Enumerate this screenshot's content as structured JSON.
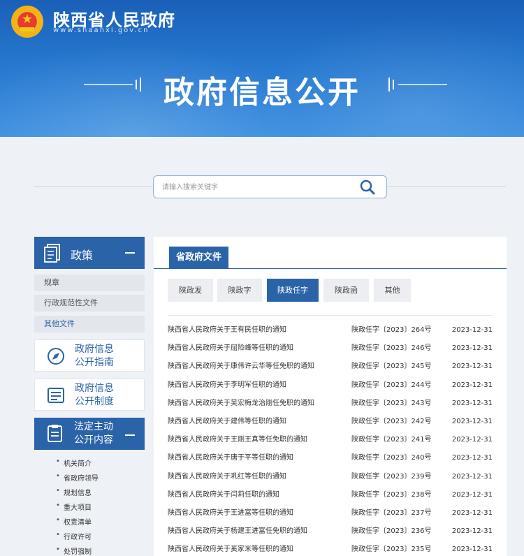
{
  "header": {
    "site_name": "陕西省人民政府",
    "site_url": "www.shaanxi.gov.cn",
    "page_title": "政府信息公开"
  },
  "search": {
    "placeholder": "请输入搜索关键字"
  },
  "sidebar": {
    "policy_title": "政策",
    "policy_items": [
      "规章",
      "行政规范性文件",
      "其他文件"
    ],
    "guide_title": [
      "政府信息",
      "公开指南"
    ],
    "system_title": [
      "政府信息",
      "公开制度"
    ],
    "proactive_title": [
      "法定主动",
      "公开内容"
    ],
    "proactive_items": [
      "机关简介",
      "省政府领导",
      "规划信息",
      "重大项目",
      "权责清单",
      "行政许可",
      "处罚强制"
    ]
  },
  "main": {
    "tab_label": "省政府文件",
    "filters": [
      "陕政发",
      "陕政字",
      "陕政任字",
      "陕政函",
      "其他"
    ],
    "active_filter": "陕政任字",
    "documents": [
      {
        "title": "陕西省人民政府关于王有民任职的通知",
        "number": "陕政任字〔2023〕264号",
        "date": "2023-12-31"
      },
      {
        "title": "陕西省人民政府关于屈险峰等任职的通知",
        "number": "陕政任字〔2023〕246号",
        "date": "2023-12-31"
      },
      {
        "title": "陕西省人民政府关于康伟许云华等任免职的通知",
        "number": "陕政任字〔2023〕245号",
        "date": "2023-12-31"
      },
      {
        "title": "陕西省人民政府关于李明军任职的通知",
        "number": "陕政任字〔2023〕244号",
        "date": "2023-12-31"
      },
      {
        "title": "陕西省人民政府关于吴宏梅龙治刚任免职的通知",
        "number": "陕政任字〔2023〕243号",
        "date": "2023-12-31"
      },
      {
        "title": "陕西省人民政府关于建伟等任职的通知",
        "number": "陕政任字〔2023〕242号",
        "date": "2023-12-31"
      },
      {
        "title": "陕西省人民政府关于王刚王真等任免职的通知",
        "number": "陕政任字〔2023〕241号",
        "date": "2023-12-31"
      },
      {
        "title": "陕西省人民政府关于唐于平等任职的通知",
        "number": "陕政任字〔2023〕240号",
        "date": "2023-12-31"
      },
      {
        "title": "陕西省人民政府关于巩红等任职的通知",
        "number": "陕政任字〔2023〕239号",
        "date": "2023-12-31"
      },
      {
        "title": "陕西省人民政府关于闫莉任职的通知",
        "number": "陕政任字〔2023〕238号",
        "date": "2023-12-31"
      },
      {
        "title": "陕西省人民政府关于王进富等任职的通知",
        "number": "陕政任字〔2023〕237号",
        "date": "2023-12-31"
      },
      {
        "title": "陕西省人民政府关于杨建王进富任免职的通知",
        "number": "陕政任字〔2023〕236号",
        "date": "2023-12-31"
      },
      {
        "title": "陕西省人民政府关于奚家米等任职的通知",
        "number": "陕政任字〔2023〕235号",
        "date": "2023-12-31"
      }
    ]
  },
  "colors": {
    "primary": "#2a63a8",
    "banner": "#2577cf",
    "background": "#eef1f6"
  }
}
